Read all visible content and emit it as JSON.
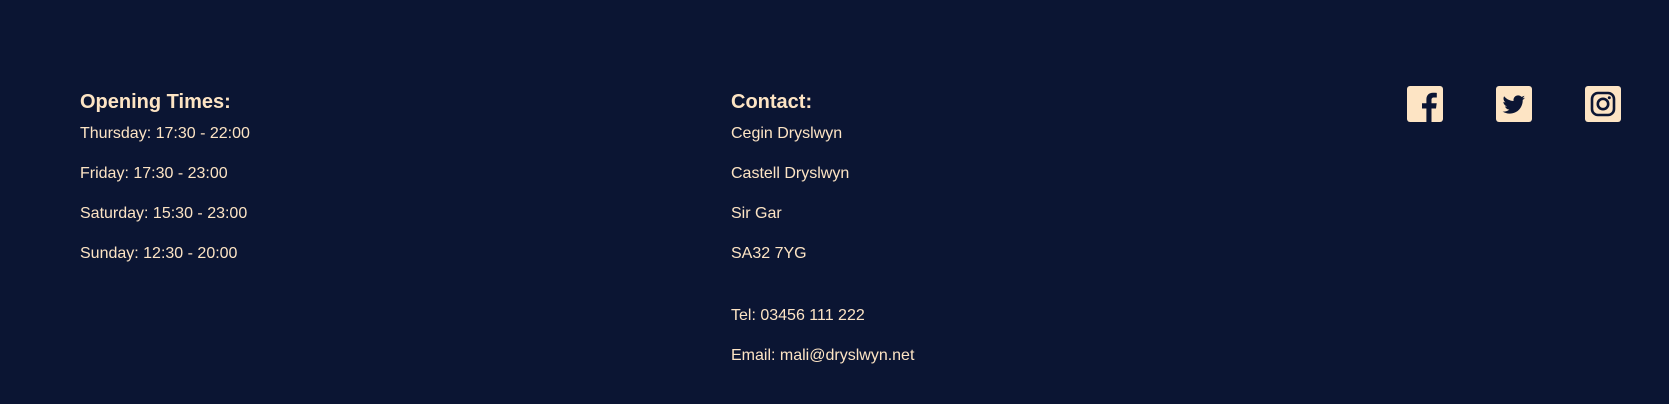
{
  "opening_times": {
    "heading": "Opening Times:",
    "lines": [
      "Thursday: 17:30 - 22:00",
      "Friday: 17:30 - 23:00",
      "Saturday: 15:30 - 23:00",
      "Sunday: 12:30 - 20:00"
    ]
  },
  "contact": {
    "heading": "Contact:",
    "address": [
      "Cegin Dryslwyn",
      "Castell Dryslwyn",
      "Sir Gar",
      "SA32 7YG"
    ],
    "tel": "Tel: 03456 111 222",
    "email": "Email: mali@dryslwyn.net"
  },
  "social": {
    "icons": [
      "facebook-icon",
      "twitter-icon",
      "instagram-icon"
    ]
  },
  "colors": {
    "background": "#0b1533",
    "text": "#fde4c4"
  }
}
